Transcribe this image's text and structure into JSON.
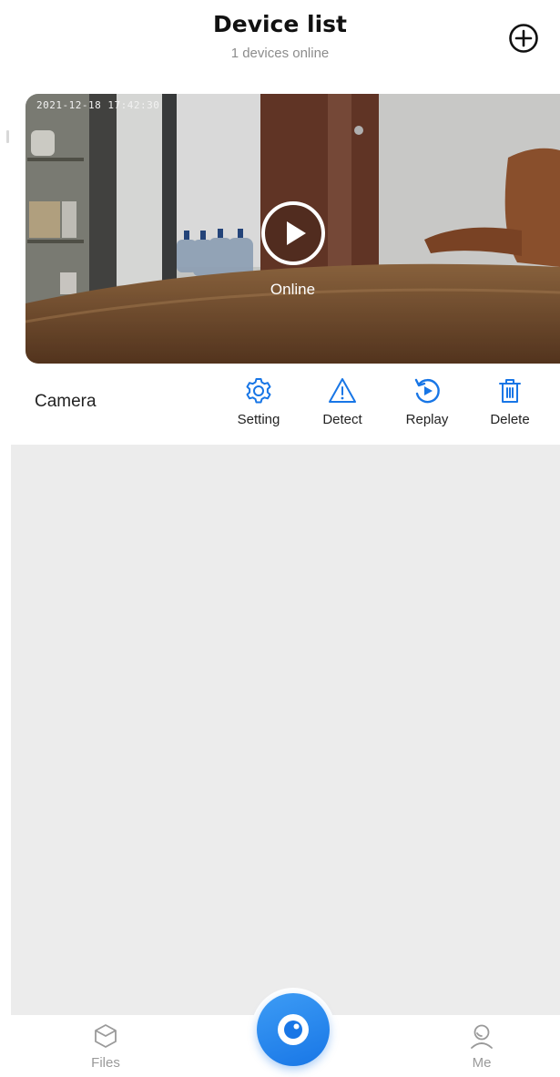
{
  "header": {
    "title": "Device list",
    "subtitle": "1 devices online",
    "add_icon": "plus-circle-icon"
  },
  "preview": {
    "timestamp": "2021-12-18 17:42:30",
    "status": "Online",
    "play_icon": "play-circle-icon"
  },
  "device": {
    "name": "Camera",
    "actions": [
      {
        "label": "Setting",
        "icon": "gear-icon"
      },
      {
        "label": "Detect",
        "icon": "warning-icon"
      },
      {
        "label": "Replay",
        "icon": "replay-icon"
      },
      {
        "label": "Delete",
        "icon": "trash-icon"
      }
    ]
  },
  "colors": {
    "accent": "#1876e6",
    "list_background": "#ececec",
    "nav_inactive": "#9a9a9a"
  },
  "bottom_nav": {
    "items": [
      {
        "label": "Files",
        "icon": "cube-icon"
      },
      {
        "label": "",
        "icon": "camera-lens-icon"
      },
      {
        "label": "Me",
        "icon": "user-icon"
      }
    ]
  }
}
